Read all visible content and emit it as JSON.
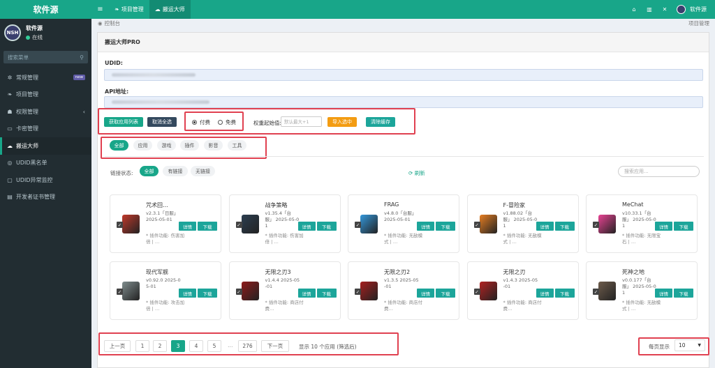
{
  "sidebar": {
    "logo": "软件源",
    "user": {
      "name": "软件源",
      "status": "在线"
    },
    "search_placeholder": "搜索菜单",
    "items": [
      {
        "label": "常规管理",
        "icon": "gears-icon",
        "badge": "new"
      },
      {
        "label": "项目管理",
        "icon": "leaf-icon"
      },
      {
        "label": "权限管理",
        "icon": "group-icon"
      },
      {
        "label": "卡密管理",
        "icon": "card-icon"
      },
      {
        "label": "搬运大师",
        "icon": "cloud-upload-icon",
        "active": true
      },
      {
        "label": "UDID黑名单",
        "icon": "circle-user-icon"
      },
      {
        "label": "UDID异常监控",
        "icon": "monitor-icon"
      },
      {
        "label": "开发者证书管理",
        "icon": "certificate-icon"
      }
    ]
  },
  "topbar": {
    "tabs": [
      {
        "label": "项目管理",
        "icon": "leaf-icon"
      },
      {
        "label": "搬运大师",
        "icon": "cloud-upload-icon",
        "active": true
      }
    ],
    "user_name": "软件源"
  },
  "breadcrumb": {
    "current": "控制台",
    "right": "项目管理"
  },
  "panel": {
    "title": "搬运大师PRO",
    "udid_label": "UDID:",
    "api_label": "API地址:",
    "buttons": {
      "fetch": "获取应用列表",
      "deselect": "取消全选",
      "import": "导入选中",
      "clear_cache": "清除缓存"
    },
    "radio": {
      "paid": "付费",
      "free": "免费",
      "selected": "paid"
    },
    "weight": {
      "label": "权重起始值:",
      "placeholder": "默认最大+1"
    },
    "categories": [
      {
        "label": "全部",
        "active": true
      },
      {
        "label": "应用"
      },
      {
        "label": "游戏"
      },
      {
        "label": "插件"
      },
      {
        "label": "影音"
      },
      {
        "label": "工具"
      }
    ],
    "link_status": {
      "label": "链接状态:",
      "options": [
        {
          "label": "全部",
          "active": true
        },
        {
          "label": "有链接"
        },
        {
          "label": "无链接"
        }
      ]
    },
    "refresh": "刷新",
    "search_placeholder": "搜索应用...",
    "detail_label": "详情",
    "download_label": "下载"
  },
  "apps": [
    {
      "name": "咒术回…",
      "meta": "v2.3.1「日服」 2025-05-01",
      "note": "* 插件功能: 伤害加倍 | …",
      "color": "#c0392b"
    },
    {
      "name": "战争策略",
      "meta": "v1.35.4「台服」 2025-05-01",
      "note": "* 插件功能: 伤害加倍 | …",
      "color": "#2c3e50"
    },
    {
      "name": "FRAG",
      "meta": "v4.8.0「台服」 2025-05-01",
      "note": "* 插件功能: 无敌模式 | …",
      "color": "#3498db"
    },
    {
      "name": "F-冒险家",
      "meta": "v1.88.02「台服」 2025-05-01",
      "note": "* 插件功能: 无敌模式 | …",
      "color": "#e67e22"
    },
    {
      "name": "MeChat",
      "meta": "v10.33.1「台服」 2025-05-01",
      "note": "* 插件功能: 无限宝石 | …",
      "color": "#e84393"
    },
    {
      "name": "现代军舰",
      "meta": "v0.92.0 2025-05-01",
      "note": "* 插件功能: 攻击加倍 | …",
      "color": "#7f8c8d"
    },
    {
      "name": "无限之刃3",
      "meta": "v1.4.4 2025-05-01",
      "note": "* 插件功能: 商店付费…",
      "color": "#8e1b1b"
    },
    {
      "name": "无限之刃2",
      "meta": "v1.3.5 2025-05-01",
      "note": "* 插件功能: 商店付费…",
      "color": "#a61e1e"
    },
    {
      "name": "无限之刃",
      "meta": "v1.4.3 2025-05-01",
      "note": "* 插件功能: 商店付费…",
      "color": "#b22222"
    },
    {
      "name": "死神之地",
      "meta": "v0.0.177「台服」 2025-05-01",
      "note": "* 插件功能: 无敌模式 | …",
      "color": "#6d5b4b"
    }
  ],
  "pagination": {
    "prev": "上一页",
    "next": "下一页",
    "pages": [
      "1",
      "2",
      "3",
      "4",
      "5"
    ],
    "current": "3",
    "ellipsis": "…",
    "last": "276",
    "info": "显示 10 个应用 (筛选后)",
    "per_page_label": "每页显示",
    "per_page_value": "10"
  },
  "colors": {
    "accent": "#18a689",
    "sidebar_bg": "#222d32",
    "highlight": "#e04050"
  }
}
